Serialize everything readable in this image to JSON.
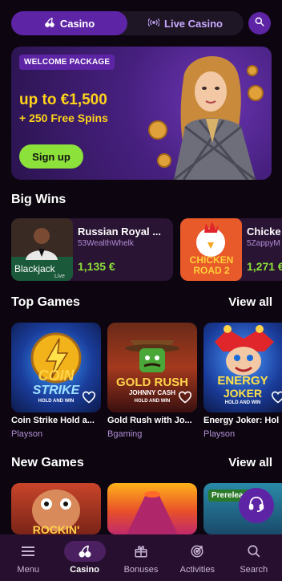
{
  "top_switcher": {
    "casino_label": "Casino",
    "live_label": "Live Casino"
  },
  "banner": {
    "tag": "WELCOME PACKAGE",
    "amount": "up to €1,500",
    "spins": "+ 250 Free Spins",
    "cta": "Sign up"
  },
  "big_wins": {
    "title": "Big Wins",
    "items": [
      {
        "game": "Russian Royal ...",
        "user": "53WealthWhelk",
        "amount": "1,135 €",
        "thumb_text": "Blackjack",
        "thumb_sub": "Live"
      },
      {
        "game": "Chicke",
        "user": "5ZappyM",
        "amount": "1,271 €",
        "thumb_text": "CHICKEN ROAD 2"
      }
    ]
  },
  "top_games": {
    "title": "Top Games",
    "view_all": "View all",
    "items": [
      {
        "name": "Coin Strike Hold a...",
        "provider": "Playson",
        "art_title": "COIN",
        "art_sub": "STRIKE",
        "art_tag": "HOLD AND WIN"
      },
      {
        "name": "Gold Rush with Jo...",
        "provider": "Bgaming",
        "art_title": "GOLD RUSH",
        "art_sub": "JOHNNY CASH",
        "art_tag": "HOLD AND WIN"
      },
      {
        "name": "Energy Joker: Hol",
        "provider": "Playson",
        "art_title": "ENERGY",
        "art_sub": "JOKER",
        "art_tag": "HOLD AND WIN"
      }
    ]
  },
  "new_games": {
    "title": "New Games",
    "view_all": "View all",
    "items": [
      {
        "art_title": "ROCKIN'"
      },
      {
        "art_title": ""
      },
      {
        "badge": "Prerelease"
      }
    ]
  },
  "bottom_nav": {
    "items": [
      {
        "label": "Menu",
        "icon": "menu-icon"
      },
      {
        "label": "Casino",
        "icon": "cherries-icon"
      },
      {
        "label": "Bonuses",
        "icon": "gift-icon"
      },
      {
        "label": "Activities",
        "icon": "target-icon"
      },
      {
        "label": "Search",
        "icon": "search-icon"
      }
    ],
    "active": "Casino"
  },
  "colors": {
    "accent_purple": "#5e24a6",
    "promo_yellow": "#ffd319",
    "win_green": "#8ce13a",
    "background": "#0d0610"
  }
}
